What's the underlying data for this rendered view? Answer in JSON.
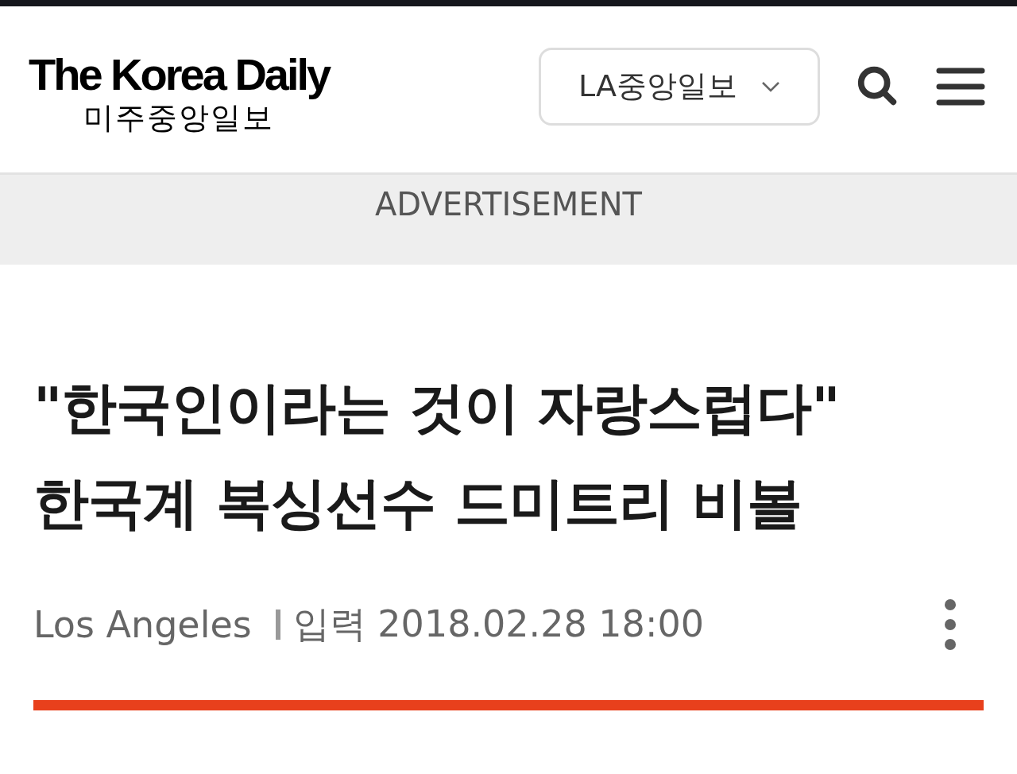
{
  "header": {
    "logo": {
      "title": "The Korea Daily",
      "subtitle": "미주중앙일보"
    },
    "edition_select": {
      "value": "LA중앙일보"
    }
  },
  "ad_banner": {
    "label": "ADVERTISEMENT"
  },
  "article": {
    "headline_lines": [
      "\"한국인이라는 것이 자랑스럽다\"",
      "한국계 복싱선수 드미트리 비볼"
    ],
    "location": "Los Angeles",
    "posted": "입력 2018.02.28 18:00"
  }
}
